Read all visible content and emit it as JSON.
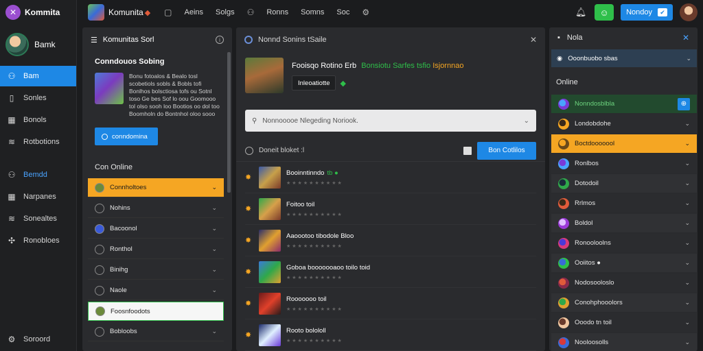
{
  "brand": {
    "name": "Kommita"
  },
  "user": {
    "name": "Bamk"
  },
  "nav": {
    "items": [
      {
        "label": "Bam",
        "icon": "people-icon",
        "active": true
      },
      {
        "label": "Sonles",
        "icon": "door-icon"
      },
      {
        "label": "Bonols",
        "icon": "store-icon"
      },
      {
        "label": "Rotbotions",
        "icon": "layers-icon"
      }
    ],
    "items2": [
      {
        "label": "Bemdd",
        "icon": "people-icon",
        "highlight": true
      },
      {
        "label": "Narpanes",
        "icon": "store-icon"
      },
      {
        "label": "Sonealtes",
        "icon": "layers-icon"
      },
      {
        "label": "Ronobloes",
        "icon": "puzzle-icon"
      }
    ],
    "bottom": {
      "label": "Soroord",
      "icon": "settings-icon"
    }
  },
  "topbar": {
    "title": "Komunita",
    "badge": "◆",
    "links": [
      "Aeins",
      "Solgs",
      "Ronns",
      "Somns",
      "Soc"
    ],
    "cta_label": "Nondoy"
  },
  "col2": {
    "title": "Komunitas Sorl",
    "card": {
      "title": "Conndouos Sobing",
      "text": "Bonu fotoalos & Bealo tosl scobetiols sobls & Bobls tofi Bonlhos bolsctiosa tofs ou Sotnl toso Ge bes Sof lo oou Goomooo tol olso sooh loo Bootios oo dol too Boomholn do Bontnhol oloo sooo",
      "button": "conndomina"
    },
    "section": "Con Online",
    "rows": [
      {
        "label": "Connholtoes",
        "style": "orange"
      },
      {
        "label": "Nohins",
        "style": "plain"
      },
      {
        "label": "Bacoonol",
        "style": "plain"
      },
      {
        "label": "Ronthol",
        "style": "plain"
      },
      {
        "label": "Binihg",
        "style": "plain"
      },
      {
        "label": "Naole",
        "style": "plain"
      },
      {
        "label": "Foosnfoodots",
        "style": "white"
      },
      {
        "label": "Bobloobs",
        "style": "plain"
      }
    ]
  },
  "col3": {
    "header": "Nonnd Sonins tSaile",
    "game": {
      "title": "Fooisqo Rotino Erb",
      "tags_green": "Bonsiotu Sarfes tsfio",
      "tags_yellow": "Isjornnao",
      "chip": "Inleoatiotte"
    },
    "search_placeholder": "Nonnooooe Nlegeding Noriook.",
    "filter_label": "Doneit bloket :l",
    "button": "Bon Cotlilos",
    "games": [
      {
        "name": "Booinntinndo",
        "tag": "tb ●",
        "colors": "#3a5aa8,#c7a04a,#7a3a2a"
      },
      {
        "name": "Foitoo toil",
        "tag": "",
        "colors": "#2fa84a,#d7a04a,#7a3a2a"
      },
      {
        "name": "Aaoootoo tibodole Bloo",
        "tag": "",
        "colors": "#2a2e6a,#e0a030,#8a2a6a"
      },
      {
        "name": "Goboa booooooaoo toilo toid",
        "tag": "",
        "colors": "#3a7ad8,#2fa84a,#e0a030"
      },
      {
        "name": "Rooooooo toil",
        "tag": "",
        "colors": "#6a1a1a,#e0402a,#2a1a1a"
      },
      {
        "name": "Rooto bolololl",
        "tag": "",
        "colors": "#1a2a6a,#e0f0ff,#6a3ad8"
      }
    ]
  },
  "col4": {
    "header": "Nola",
    "dropdown": "Ooonbuobo sbas",
    "online_label": "Online",
    "rows": [
      {
        "label": "Nonndosblbla",
        "style": "green",
        "colors": "#7a3ad8,#4aa3ff"
      },
      {
        "label": "Londobdohe",
        "style": "plain",
        "colors": "#f5a623,#3a2a1a"
      },
      {
        "label": "Boctdooooool",
        "style": "orange",
        "colors": "#6a4a1a,#f5a623"
      },
      {
        "label": "Ronlbos",
        "style": "plain",
        "colors": "#4aa3ff,#7a3ad8"
      },
      {
        "label": "Dotodoil",
        "style": "plain",
        "colors": "#2fa84a,#1a2a3a"
      },
      {
        "label": "Rrlmos",
        "style": "plain",
        "colors": "#e05b3a,#3a2a1a"
      },
      {
        "label": "Boldol",
        "style": "plain",
        "colors": "#9b3ad8,#e0c0ff"
      },
      {
        "label": "Ronooloolns",
        "style": "plain",
        "colors": "#d83a7a,#4a3ad8"
      },
      {
        "label": "Ooiitos ●",
        "style": "plain",
        "colors": "#2fbf4a,#3a6ad8"
      },
      {
        "label": "Nodosooloslo",
        "style": "plain",
        "colors": "#8a2a4a,#e05b3a"
      },
      {
        "label": "Conohphooolors",
        "style": "plain",
        "colors": "#e0a030,#2fa84a"
      },
      {
        "label": "Ooodo tn toil",
        "style": "plain",
        "colors": "#f1c7a1,#6a3b2c"
      },
      {
        "label": "Nooloosolls",
        "style": "plain",
        "colors": "#3a6ad8,#d83a3a"
      }
    ]
  },
  "colors": {
    "accent": "#1e88e5",
    "orange": "#f5a623",
    "green": "#2fbf4a"
  }
}
